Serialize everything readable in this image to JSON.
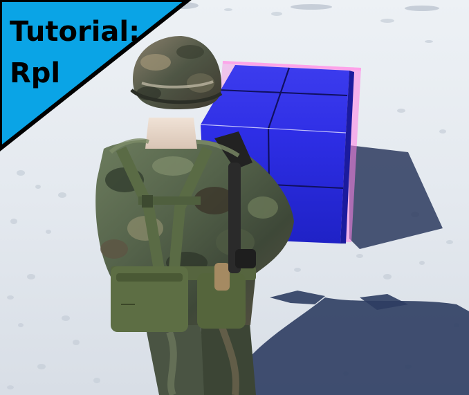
{
  "tutorial_card": {
    "line1": "Tutorial:",
    "line2": "Rpl",
    "background_color": "#0aa4e6",
    "border_color": "#000000"
  },
  "scene": {
    "ground": "snow",
    "objects": [
      "soldier-character",
      "blue-cube-object",
      "pink-bounding-box"
    ],
    "colors": {
      "cube": "#3a3ae8",
      "bounding_box": "#ff66cc",
      "snow": "#e8edf2"
    }
  }
}
